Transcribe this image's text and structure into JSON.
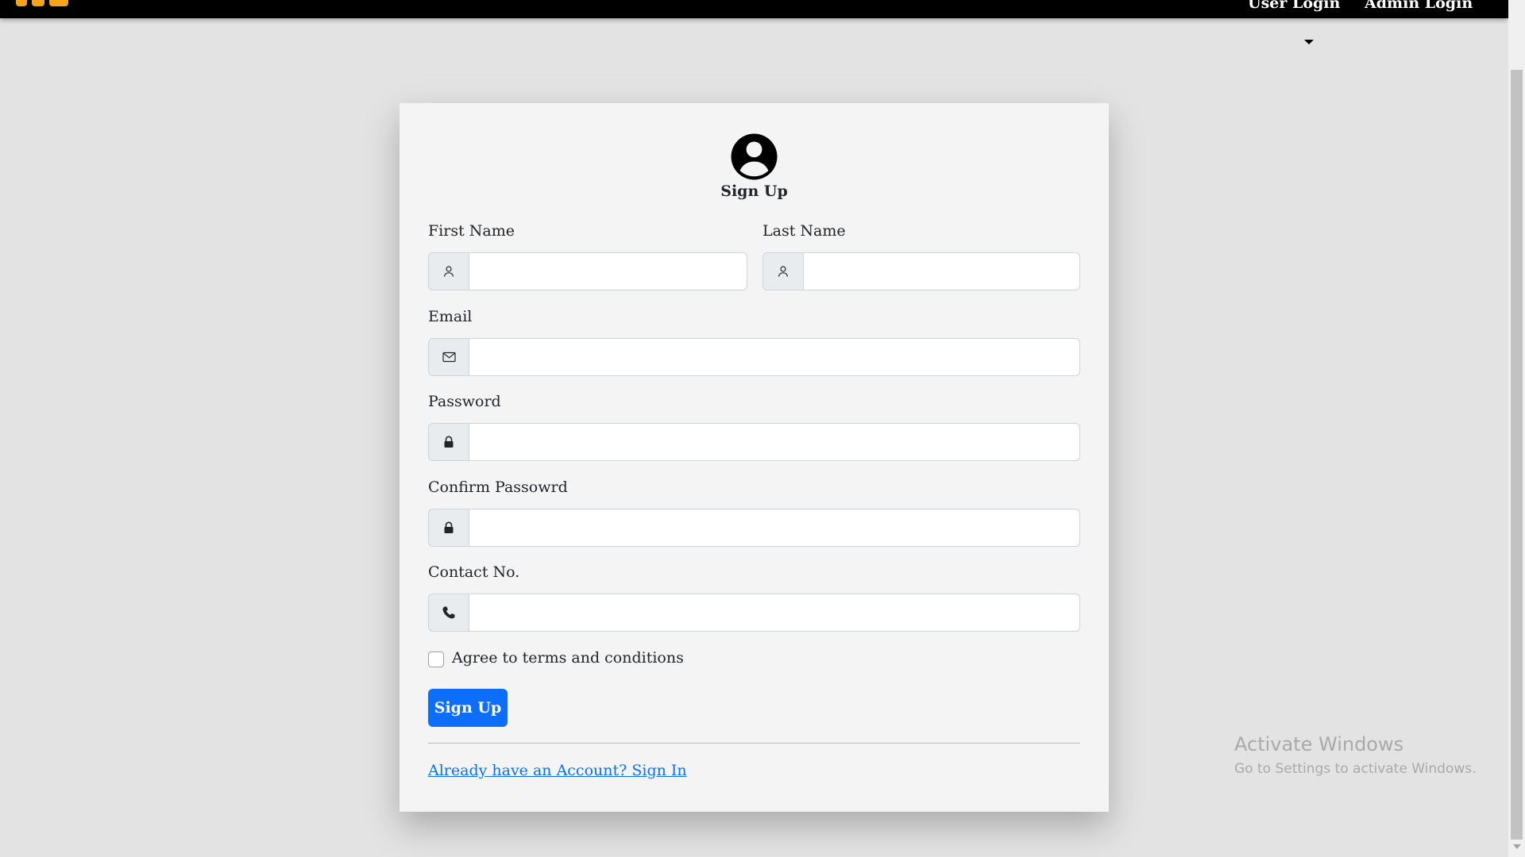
{
  "navbar": {
    "links": [
      {
        "label": "User Login"
      },
      {
        "label": "Admin Login"
      }
    ]
  },
  "form": {
    "title": "Sign Up",
    "first_name": {
      "label": "First Name",
      "value": "",
      "icon": "user-icon"
    },
    "last_name": {
      "label": "Last Name",
      "value": "",
      "icon": "user-icon"
    },
    "email": {
      "label": "Email",
      "value": "",
      "icon": "envelope-icon"
    },
    "password": {
      "label": "Password",
      "value": "",
      "icon": "lock-icon"
    },
    "confirm_password": {
      "label": "Confirm Passowrd",
      "value": "",
      "icon": "lock-icon"
    },
    "contact": {
      "label": "Contact No.",
      "value": "",
      "icon": "phone-icon"
    },
    "terms": {
      "label": "Agree to terms and conditions",
      "checked": false
    },
    "submit_label": "Sign Up",
    "signin_link": "Already have an Account? Sign In"
  },
  "watermark": {
    "title": "Activate Windows",
    "subtitle": "Go to Settings to activate Windows."
  },
  "colors": {
    "primary": "#0d6efd",
    "brand": "#f7a21b",
    "navbar": "#000000",
    "background": "#e3e3e3"
  }
}
